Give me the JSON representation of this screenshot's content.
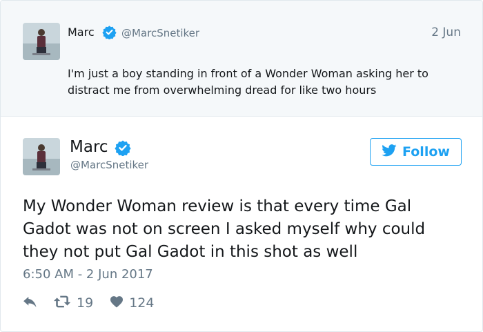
{
  "parent_tweet": {
    "author_name": "Marc",
    "author_handle": "@MarcSnetiker",
    "date": "2 Jun",
    "text": "I'm just a boy standing in front of a Wonder Woman asking her to distract me from overwhelming dread for like two hours"
  },
  "main_tweet": {
    "author_name": "Marc",
    "author_handle": "@MarcSnetiker",
    "follow_label": "Follow",
    "text": "My Wonder Woman review is that every time Gal Gadot was not on screen I asked myself why could they not put Gal Gadot in this shot as well",
    "timestamp": "6:50 AM - 2 Jun 2017",
    "retweets": "19",
    "likes": "124"
  },
  "icons": {
    "verified": "verified-badge-icon",
    "bird": "twitter-bird-icon",
    "reply": "reply-icon",
    "retweet": "retweet-icon",
    "like": "heart-icon"
  },
  "colors": {
    "accent": "#1da1f2",
    "secondary_text": "#657786",
    "primary_text": "#14171a",
    "parent_bg": "#f5f8fa",
    "verified": "#1da1f2"
  }
}
